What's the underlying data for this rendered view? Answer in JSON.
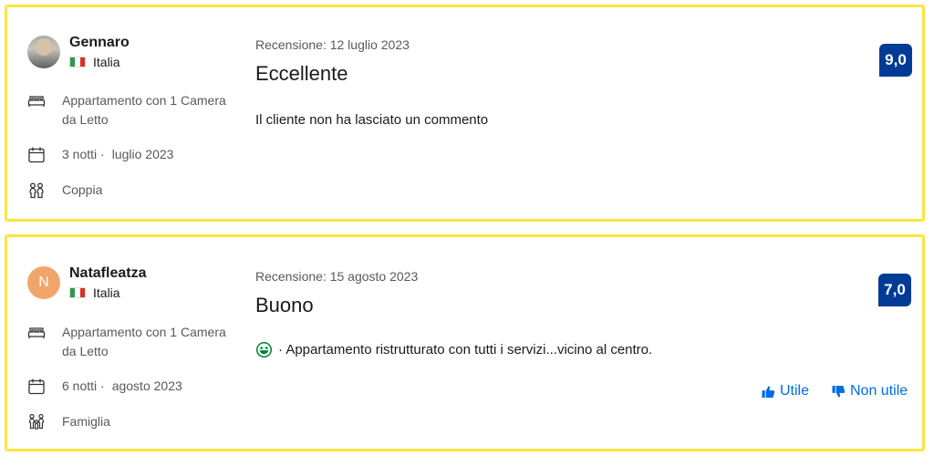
{
  "reviews": [
    {
      "reviewer": "Gennaro",
      "country": "Italia",
      "room": "Appartamento con 1 Camera da Letto",
      "nights": "3 notti ·",
      "stay_month": "luglio 2023",
      "traveler_type": "Coppia",
      "review_date": "Recensione: 12 luglio 2023",
      "title": "Eccellente",
      "body": "Il cliente non ha lasciato un commento",
      "score": "9,0"
    },
    {
      "reviewer": "Natafleatza",
      "avatar_initial": "N",
      "country": "Italia",
      "room": "Appartamento con 1 Camera da Letto",
      "nights": "6 notti ·",
      "stay_month": "agosto 2023",
      "traveler_type": "Famiglia",
      "review_date": "Recensione: 15 agosto 2023",
      "title": "Buono",
      "body": "· Appartamento ristrutturato con tutti i servizi...vicino al centro.",
      "score": "7,0",
      "helpful_label": "Utile",
      "not_helpful_label": "Non utile"
    }
  ],
  "colors": {
    "highlight_border": "#fde541",
    "score_badge": "#003b95",
    "link": "#006ce4",
    "positive": "#008234"
  },
  "icons": [
    "bed-icon",
    "calendar-icon",
    "people-icon",
    "family-icon",
    "smile-icon",
    "thumbs-up-icon",
    "thumbs-down-icon"
  ]
}
